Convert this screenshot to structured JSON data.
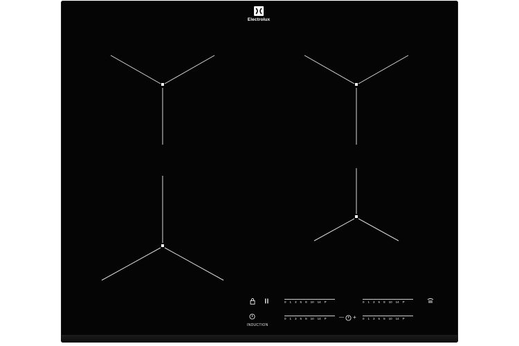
{
  "brand": {
    "name": "Electrolux"
  },
  "labels": {
    "induction": "INDUCTION"
  },
  "sliders": {
    "front_left": [
      "0",
      "1",
      "3",
      "5",
      "8",
      "10",
      "14",
      "P"
    ],
    "back_right": [
      "0",
      "1",
      "3",
      "5",
      "8",
      "10",
      "14",
      "P"
    ],
    "front_left_lower": [
      "0",
      "1",
      "3",
      "5",
      "8",
      "10",
      "14",
      "P"
    ],
    "front_right_lower": [
      "0",
      "1",
      "3",
      "5",
      "8",
      "10",
      "14",
      "P"
    ]
  },
  "timer": {
    "minus": "—",
    "plus": "+"
  },
  "colors": {
    "glass": "#050505",
    "markings": "#ffffff"
  }
}
